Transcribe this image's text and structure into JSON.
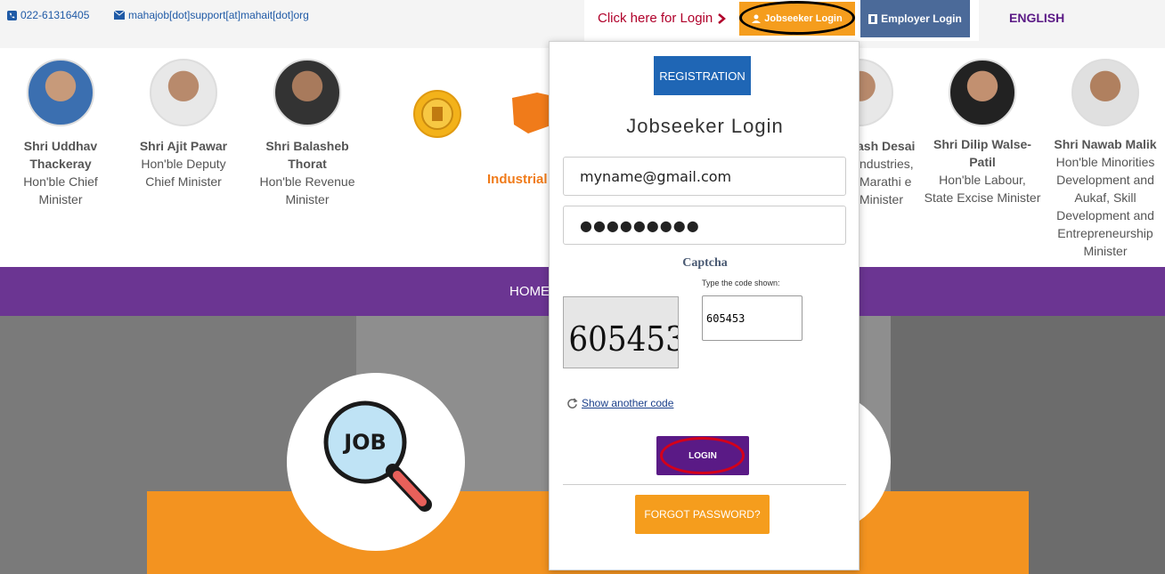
{
  "topbar": {
    "phone": "022-61316405",
    "email": "mahajob[dot]support[at]mahait[dot]org",
    "click_login": "Click here for Login",
    "jobseeker_login": "Jobseeker Login",
    "employer_login": "Employer Login",
    "language": "ENGLISH"
  },
  "ministers": [
    {
      "name": "Shri Uddhav Thackeray",
      "role": "Hon'ble Chief Minister"
    },
    {
      "name": "Shri Ajit Pawar",
      "role": "Hon'ble Deputy Chief Minister"
    },
    {
      "name": "Shri Balasheb Thorat",
      "role": "Hon'ble Revenue Minister"
    },
    {
      "name": "ash Desai",
      "role": "ndustries, Marathi e Minister"
    },
    {
      "name": "Shri Dilip Walse-Patil",
      "role": "Hon'ble Labour, State Excise Minister"
    },
    {
      "name": "Shri Nawab Malik",
      "role": "Hon'ble Minorities Development and Aukaf, Skill Development and Entrepreneurship Minister"
    }
  ],
  "header": {
    "industrial_text": "Industrial"
  },
  "nav": {
    "home": "HOME"
  },
  "login_panel": {
    "registration": "REGISTRATION",
    "title": "Jobseeker Login",
    "email_value": "myname@gmail.com",
    "password_value": "●●●●●●●●●",
    "captcha_label": "Captcha",
    "type_code_label": "Type the code shown:",
    "captcha_code": "605453",
    "captcha_input_value": "605453",
    "show_another": "Show another code",
    "login": "LOGIN",
    "forgot": "FORGOT PASSWORD?"
  },
  "hero": {
    "job_badge": "JOB"
  },
  "colors": {
    "purple": "#6b3592",
    "orange": "#f59d1d",
    "blue": "#1f66b5"
  }
}
